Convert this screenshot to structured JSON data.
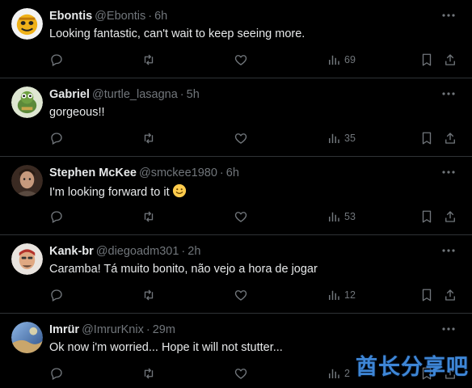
{
  "replies": [
    {
      "name": "Ebontis",
      "handle": "@Ebontis",
      "time": "6h",
      "text": "Looking fantastic, can't wait to keep seeing more.",
      "views": "69"
    },
    {
      "name": "Gabriel",
      "handle": "@turtle_lasagna",
      "time": "5h",
      "text": "gorgeous!!",
      "views": "35"
    },
    {
      "name": "Stephen McKee",
      "handle": "@smckee1980",
      "time": "6h",
      "text": "I'm looking forward to it",
      "views": "53"
    },
    {
      "name": "Kank-br",
      "handle": "@diegoadm301",
      "time": "2h",
      "text": "Caramba! Tá muito bonito, não vejo a hora de jogar",
      "views": "12"
    },
    {
      "name": "Imrür",
      "handle": "@ImrurKnix",
      "time": "29m",
      "text": "Ok now i'm worried... Hope it will not stutter...",
      "views": "2"
    }
  ],
  "separator": "·",
  "watermark": "酋长分享吧",
  "icons": [
    "reply-icon",
    "retweet-icon",
    "like-icon",
    "views-icon",
    "bookmark-icon",
    "share-icon",
    "more-icon"
  ],
  "colors": {
    "background": "#000000",
    "text": "#e7e9ea",
    "muted": "#71767b",
    "divider": "#2f3336",
    "watermark": "#3e86d6"
  }
}
